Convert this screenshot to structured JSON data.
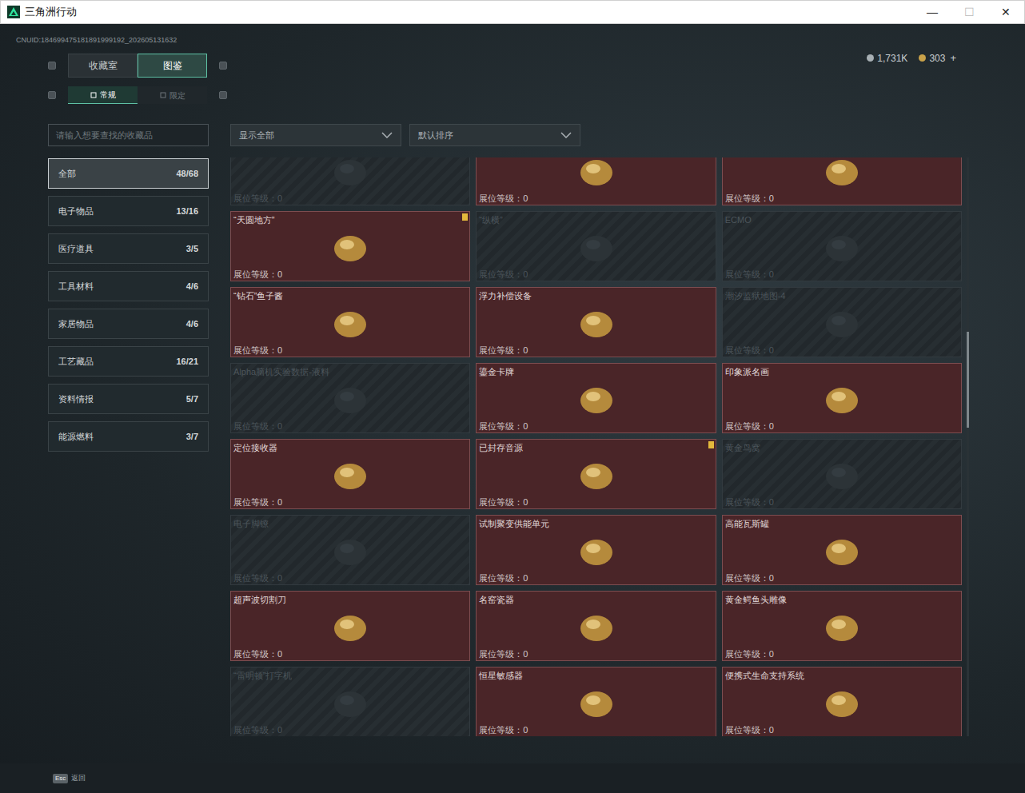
{
  "window": {
    "title": "三角洲行动",
    "controls": [
      "—",
      "☐",
      "✕"
    ]
  },
  "uid": "CNUID:184699475181891999192_202605131632",
  "currency": [
    {
      "amount": "1,731K",
      "color": "#a8b0b4"
    },
    {
      "amount": "303",
      "color": "#c9a24a"
    }
  ],
  "currency_add": "+",
  "tabs": [
    {
      "label": "收藏室",
      "selected": false
    },
    {
      "label": "图鉴",
      "selected": true
    }
  ],
  "subtabs": [
    {
      "label": "常规",
      "selected": true
    },
    {
      "label": "限定",
      "selected": false
    }
  ],
  "search": {
    "placeholder": "请输入想要查找的收藏品"
  },
  "filters": [
    {
      "label": "显示全部"
    },
    {
      "label": "默认排序"
    }
  ],
  "categories": [
    {
      "label": "全部",
      "count": "48/68",
      "selected": true
    },
    {
      "label": "电子物品",
      "count": "13/16",
      "selected": false
    },
    {
      "label": "医疗道具",
      "count": "3/5",
      "selected": false
    },
    {
      "label": "工具材料",
      "count": "4/6",
      "selected": false
    },
    {
      "label": "家居物品",
      "count": "4/6",
      "selected": false
    },
    {
      "label": "工艺藏品",
      "count": "16/21",
      "selected": false
    },
    {
      "label": "资料情报",
      "count": "5/7",
      "selected": false
    },
    {
      "label": "能源燃料",
      "count": "3/7",
      "selected": false
    }
  ],
  "items": [
    {
      "name": "",
      "level_label": "展位等级：",
      "level": "0",
      "owned": false,
      "badge": false
    },
    {
      "name": "",
      "level_label": "展位等级：",
      "level": "0",
      "owned": true,
      "badge": false
    },
    {
      "name": "",
      "level_label": "展位等级：",
      "level": "0",
      "owned": true,
      "badge": false
    },
    {
      "name": "“天圆地方”",
      "level_label": "展位等级：",
      "level": "0",
      "owned": true,
      "badge": true
    },
    {
      "name": "“纵横”",
      "level_label": "展位等级：",
      "level": "0",
      "owned": false,
      "badge": false
    },
    {
      "name": "ECMO",
      "level_label": "展位等级：",
      "level": "0",
      "owned": false,
      "badge": false
    },
    {
      "name": "“钻石”鱼子酱",
      "level_label": "展位等级：",
      "level": "0",
      "owned": true,
      "badge": false
    },
    {
      "name": "浮力补偿设备",
      "level_label": "展位等级：",
      "level": "0",
      "owned": true,
      "badge": false
    },
    {
      "name": "潮汐监狱地图-4",
      "level_label": "展位等级：",
      "level": "0",
      "owned": false,
      "badge": false
    },
    {
      "name": "Alpha脑机实验数据-液料",
      "level_label": "展位等级：",
      "level": "0",
      "owned": false,
      "badge": false
    },
    {
      "name": "鎏金卡牌",
      "level_label": "展位等级：",
      "level": "0",
      "owned": true,
      "badge": false
    },
    {
      "name": "印象派名画",
      "level_label": "展位等级：",
      "level": "0",
      "owned": true,
      "badge": false
    },
    {
      "name": "定位接收器",
      "level_label": "展位等级：",
      "level": "0",
      "owned": true,
      "badge": false
    },
    {
      "name": "已封存音源",
      "level_label": "展位等级：",
      "level": "0",
      "owned": true,
      "badge": true
    },
    {
      "name": "黄金鸟窝",
      "level_label": "展位等级：",
      "level": "0",
      "owned": false,
      "badge": false
    },
    {
      "name": "电子脚镣",
      "level_label": "展位等级：",
      "level": "0",
      "owned": false,
      "badge": false
    },
    {
      "name": "试制聚变供能单元",
      "level_label": "展位等级：",
      "level": "0",
      "owned": true,
      "badge": false
    },
    {
      "name": "高能瓦斯罐",
      "level_label": "展位等级：",
      "level": "0",
      "owned": true,
      "badge": false
    },
    {
      "name": "超声波切割刀",
      "level_label": "展位等级：",
      "level": "0",
      "owned": true,
      "badge": false
    },
    {
      "name": "名窑瓷器",
      "level_label": "展位等级：",
      "level": "0",
      "owned": true,
      "badge": false
    },
    {
      "name": "黄金鳄鱼头雕像",
      "level_label": "展位等级：",
      "level": "0",
      "owned": true,
      "badge": false
    },
    {
      "name": "“雷明顿”打字机",
      "level_label": "展位等级：",
      "level": "0",
      "owned": false,
      "badge": false
    },
    {
      "name": "恒星敏感器",
      "level_label": "展位等级：",
      "level": "0",
      "owned": true,
      "badge": false
    },
    {
      "name": "便携式生命支持系统",
      "level_label": "展位等级：",
      "level": "0",
      "owned": true,
      "badge": false
    }
  ],
  "footer": {
    "key": "Esc",
    "label": "返回"
  }
}
